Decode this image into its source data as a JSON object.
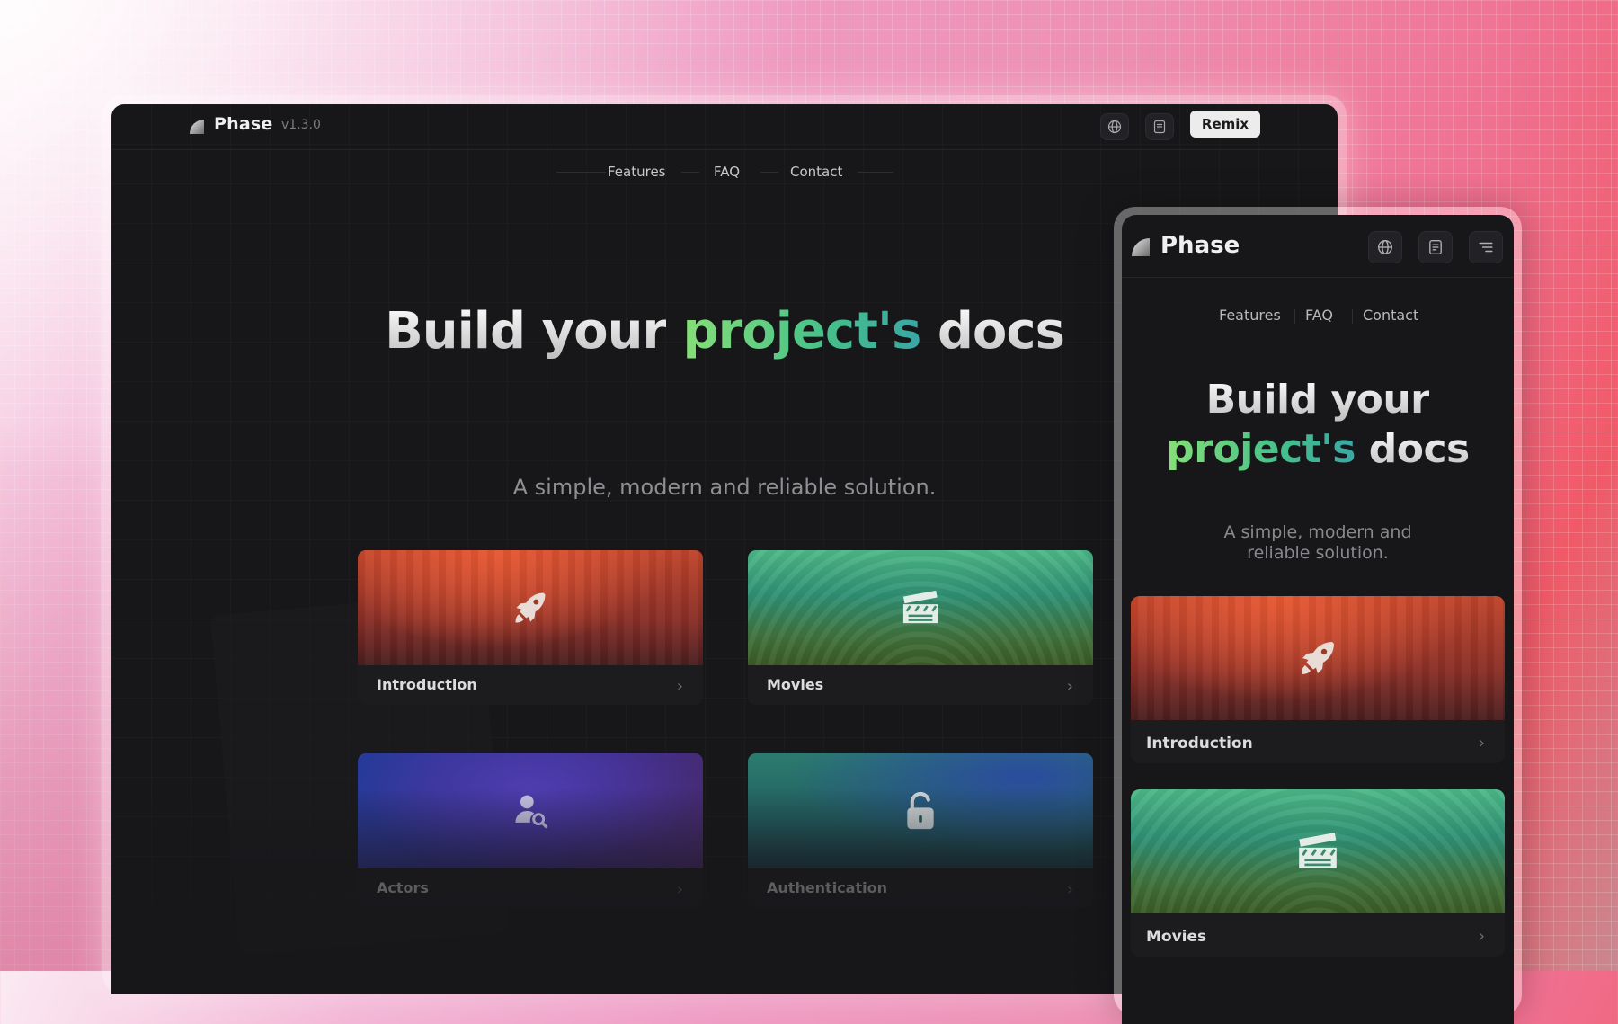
{
  "brand": "Phase",
  "version": "v1.3.0",
  "header": {
    "remix_label": "Remix"
  },
  "nav": [
    "Features",
    "FAQ",
    "Contact"
  ],
  "hero": {
    "line_a": "Build your",
    "highlight": "project's",
    "line_b": "docs"
  },
  "subtitle": "A simple, modern and reliable solution.",
  "cards": [
    {
      "label": "Introduction",
      "icon": "rocket-icon",
      "theme": "orange"
    },
    {
      "label": "Movies",
      "icon": "clapperboard-icon",
      "theme": "green"
    },
    {
      "label": "Actors",
      "icon": "actor-search-icon",
      "theme": "blue"
    },
    {
      "label": "Authentication",
      "icon": "unlock-icon",
      "theme": "teal"
    }
  ],
  "colors": {
    "accent_green": "#7ddc7a",
    "accent_teal": "#3aa7a5",
    "surface": "#17171a",
    "orange_card": "#c0442b",
    "green_card": "#3f9a77",
    "blue_card": "#2f3796",
    "teal_card": "#2a6c6c"
  }
}
